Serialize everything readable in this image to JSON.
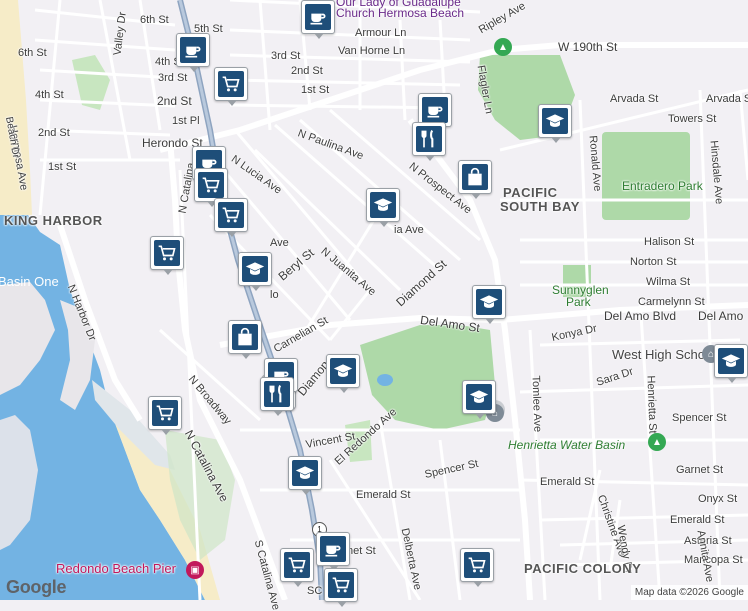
{
  "map": {
    "water_color": "#73b3e3",
    "land_color": "#f2f0f4",
    "park_color": "#aed9a8",
    "road_color": "#ffffff",
    "highway_color": "#8ea4c0",
    "marker_color": "#1e4e79"
  },
  "labels": {
    "lady_church": "Our Lady of Guadalupe",
    "church": "Church Hermosa Beach",
    "ripley": "Ripley Ave",
    "armour": "Armour Ln",
    "van_horne": "Van Horne Ln",
    "w190": "W 190th St",
    "sixth_st_a": "6th St",
    "fifth_st": "5th St",
    "valley_dr": "Valley Dr",
    "sixth_st_b": "6th St",
    "fourth_st_a": "4th St",
    "third_st_a": "3rd St",
    "third_st_b": "3rd St",
    "second_st_a": "2nd St",
    "second_st_b": "2nd St",
    "second_st_c": "2nd St",
    "first_st_a": "1st St",
    "first_st_b": "1st St",
    "first_pl": "1st Pl",
    "fourth_st_b": "4th St",
    "hermosa_ave": "Hermosa Ave",
    "beach_dr": "Beach Dr",
    "herondo": "Herondo St",
    "paulina": "N Paulina Ave",
    "lucia": "N Lucia Ave",
    "flagler": "Flagler Ln",
    "arvada_a": "Arvada St",
    "arvada_b": "Arvada St",
    "towers": "Towers St",
    "ronald": "Ronald Ave",
    "prospect_a": "N Prospect Ave",
    "prospect_b": "N Prospect Ave",
    "pacific_south_bay_1": "PACIFIC",
    "pacific_south_bay_2": "SOUTH BAY",
    "entradero_park": "Entradero Park",
    "hinsdale": "Hinsdale Ave",
    "king_harbor": "KING HARBOR",
    "catalina_a": "N Catalina",
    "beryl": "Beryl St",
    "juanita": "N Juanita Ave",
    "diamond_a": "Diamond St",
    "halison": "Halison St",
    "norton": "Norton St",
    "wilma": "Wilma St",
    "carmelynn": "Carmelynn St",
    "sunnyglen": "Sunnyglen",
    "sunnyglen_park": "Park",
    "basin_one": "Basin One",
    "harbor_dr": "N Harbor Dr",
    "carnelian": "Carnelian St",
    "del_amo_st": "Del Amo St",
    "del_amo_blvd": "Del Amo Blvd",
    "del_amo_end": "Del Amo",
    "konya": "Konya Dr",
    "west_high": "West High School",
    "sara": "Sara Dr",
    "tomlee": "Tomlee Ave",
    "henrietta": "Henrietta St",
    "spencer_a": "Spencer St",
    "spencer_b": "Spencer St",
    "n_broadway": "N Broadway",
    "n_catalina_b": "N Catalina Ave",
    "diamond_b": "Diamon",
    "vincent": "Vincent St",
    "el_redondo": "El Redondo Ave",
    "henrietta_water": "Henrietta Water Basin",
    "garnet": "Garnet St",
    "emerald_a": "Emerald St",
    "emerald_b": "Emerald St",
    "emerald_c": "Emerald St",
    "onyx": "Onyx St",
    "asteria": "Asteria St",
    "maricopa": "Maricopa St",
    "christine": "Christine Ave",
    "wendy": "Wendy Dr",
    "annita": "Annita Ave",
    "delberta": "Delberta Ave",
    "s_catalina": "S Catalina Ave",
    "redondo_pier": "Redondo Beach Pier",
    "pacific_colony": "PACIFIC COLONY",
    "street_st": "net St",
    "b_ave": "Ave",
    "ia_ave": "ia Ave",
    "ng": "lo",
    "so": "SC"
  },
  "route_shields": {
    "r1": "1"
  },
  "markers": [
    {
      "icon": "coffee-icon",
      "type": "cafe"
    },
    {
      "icon": "coffee-icon",
      "type": "cafe"
    },
    {
      "icon": "shopping-cart-icon",
      "type": "grocery"
    },
    {
      "icon": "school-icon",
      "type": "school"
    },
    {
      "icon": "coffee-icon",
      "type": "cafe"
    },
    {
      "icon": "restaurant-icon",
      "type": "restaurant"
    },
    {
      "icon": "school-icon",
      "type": "school"
    },
    {
      "icon": "shopping-bag-icon",
      "type": "shopping"
    },
    {
      "icon": "coffee-icon",
      "type": "cafe"
    },
    {
      "icon": "shopping-cart-icon",
      "type": "grocery"
    },
    {
      "icon": "school-icon",
      "type": "school"
    },
    {
      "icon": "shopping-cart-icon",
      "type": "grocery"
    },
    {
      "icon": "shopping-cart-icon",
      "type": "grocery"
    },
    {
      "icon": "school-icon",
      "type": "school"
    },
    {
      "icon": "restaurant-icon",
      "type": "restaurant"
    },
    {
      "icon": "shopping-bag-icon",
      "type": "shopping"
    },
    {
      "icon": "school-icon",
      "type": "school"
    },
    {
      "icon": "coffee-icon",
      "type": "cafe"
    },
    {
      "icon": "restaurant-icon",
      "type": "restaurant"
    },
    {
      "icon": "school-icon",
      "type": "school"
    },
    {
      "icon": "shopping-cart-icon",
      "type": "grocery"
    },
    {
      "icon": "school-icon",
      "type": "school"
    },
    {
      "icon": "coffee-icon",
      "type": "cafe"
    },
    {
      "icon": "shopping-cart-icon",
      "type": "grocery"
    },
    {
      "icon": "shopping-cart-icon",
      "type": "grocery"
    },
    {
      "icon": "shopping-cart-icon",
      "type": "grocery"
    },
    {
      "icon": "school-icon",
      "type": "school"
    }
  ],
  "footer": {
    "logo": "Google",
    "credits": "Map data ©2026 Google"
  }
}
